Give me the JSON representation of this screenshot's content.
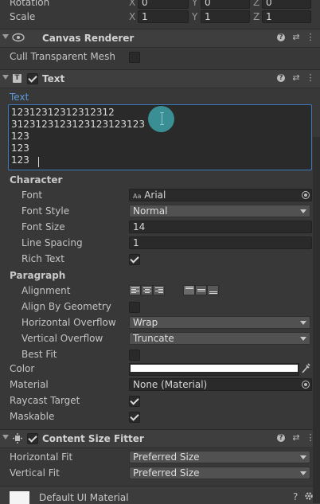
{
  "transform": {
    "rotation_label": "Rotation",
    "rotation": {
      "x_label": "X",
      "x": "0",
      "y_label": "Y",
      "y": "0",
      "z_label": "Z",
      "z": "0"
    },
    "scale_label": "Scale",
    "scale": {
      "x_label": "X",
      "x": "1",
      "y_label": "Y",
      "y": "1",
      "z_label": "Z",
      "z": "1"
    }
  },
  "canvas_renderer": {
    "title": "Canvas Renderer",
    "cull_label": "Cull Transparent Mesh",
    "cull": false
  },
  "text_component": {
    "title": "Text",
    "enabled": true,
    "text_label": "Text",
    "text_lines": [
      "12312312312312312",
      "31231231231231231231 23"
    ],
    "lines": [
      "12312312312312312",
      "3123123123123123123123",
      "123",
      "123",
      "123"
    ],
    "character_header": "Character",
    "font_label": "Font",
    "font_icon_text": "Aa",
    "font_value": "Arial",
    "font_style_label": "Font Style",
    "font_style_value": "Normal",
    "font_size_label": "Font Size",
    "font_size_value": "14",
    "line_spacing_label": "Line Spacing",
    "line_spacing_value": "1",
    "rich_text_label": "Rich Text",
    "rich_text": true,
    "paragraph_header": "Paragraph",
    "alignment_label": "Alignment",
    "align_geometry_label": "Align By Geometry",
    "align_geometry": false,
    "horizontal_overflow_label": "Horizontal Overflow",
    "horizontal_overflow_value": "Wrap",
    "vertical_overflow_label": "Vertical Overflow",
    "vertical_overflow_value": "Truncate",
    "best_fit_label": "Best Fit",
    "best_fit": false,
    "color_label": "Color",
    "color_value": "#ffffff",
    "material_label": "Material",
    "material_value": "None (Material)",
    "raycast_label": "Raycast Target",
    "raycast": true,
    "maskable_label": "Maskable",
    "maskable": true
  },
  "content_size_fitter": {
    "title": "Content Size Fitter",
    "enabled": true,
    "horizontal_fit_label": "Horizontal Fit",
    "horizontal_fit_value": "Preferred Size",
    "vertical_fit_label": "Vertical Fit",
    "vertical_fit_value": "Preferred Size"
  },
  "material_footer": {
    "title": "Default UI Material"
  },
  "icons": {
    "help": "?",
    "presets": "⇄",
    "menu": "⋮"
  },
  "colors": {
    "accent": "#3a79bb",
    "cursor_highlight": "#3a8f95"
  }
}
